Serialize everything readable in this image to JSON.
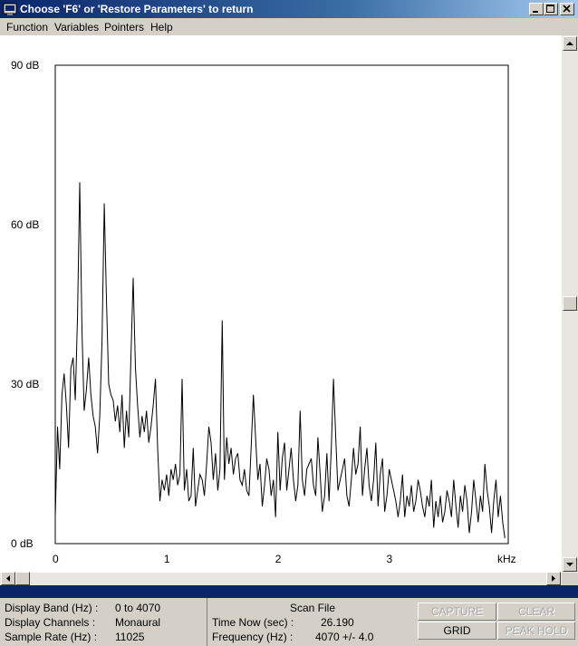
{
  "window": {
    "title": "Choose 'F6' or 'Restore Parameters' to return"
  },
  "menu": [
    "Function",
    "Variables",
    "Pointers",
    "Help"
  ],
  "chart_data": {
    "type": "line",
    "title": "",
    "xlabel": "kHz",
    "ylabel": "",
    "xlim": [
      0,
      4.07
    ],
    "ylim": [
      0,
      90
    ],
    "y_ticks": [
      "0 dB",
      "30 dB",
      "60 dB",
      "90 dB"
    ],
    "x_ticks": [
      "0",
      "1",
      "2",
      "3"
    ],
    "grid": false,
    "x": [
      0.0,
      0.02,
      0.04,
      0.06,
      0.08,
      0.1,
      0.12,
      0.14,
      0.16,
      0.18,
      0.2,
      0.22,
      0.24,
      0.26,
      0.28,
      0.3,
      0.32,
      0.34,
      0.36,
      0.38,
      0.4,
      0.42,
      0.44,
      0.46,
      0.48,
      0.5,
      0.52,
      0.54,
      0.56,
      0.58,
      0.6,
      0.62,
      0.64,
      0.66,
      0.68,
      0.7,
      0.72,
      0.74,
      0.76,
      0.78,
      0.8,
      0.82,
      0.84,
      0.86,
      0.88,
      0.9,
      0.92,
      0.94,
      0.96,
      0.98,
      1.0,
      1.02,
      1.04,
      1.06,
      1.08,
      1.1,
      1.12,
      1.14,
      1.16,
      1.18,
      1.2,
      1.22,
      1.24,
      1.26,
      1.28,
      1.3,
      1.32,
      1.34,
      1.36,
      1.38,
      1.4,
      1.42,
      1.44,
      1.46,
      1.48,
      1.5,
      1.52,
      1.54,
      1.56,
      1.58,
      1.6,
      1.62,
      1.64,
      1.66,
      1.68,
      1.7,
      1.72,
      1.74,
      1.76,
      1.78,
      1.8,
      1.82,
      1.84,
      1.86,
      1.88,
      1.9,
      1.92,
      1.94,
      1.96,
      1.98,
      2.0,
      2.02,
      2.04,
      2.06,
      2.08,
      2.1,
      2.12,
      2.14,
      2.16,
      2.18,
      2.2,
      2.22,
      2.24,
      2.26,
      2.28,
      2.3,
      2.32,
      2.34,
      2.36,
      2.38,
      2.4,
      2.42,
      2.44,
      2.46,
      2.48,
      2.5,
      2.52,
      2.54,
      2.56,
      2.58,
      2.6,
      2.62,
      2.64,
      2.66,
      2.68,
      2.7,
      2.72,
      2.74,
      2.76,
      2.78,
      2.8,
      2.82,
      2.84,
      2.86,
      2.88,
      2.9,
      2.92,
      2.94,
      2.96,
      2.98,
      3.0,
      3.02,
      3.04,
      3.06,
      3.08,
      3.1,
      3.12,
      3.14,
      3.16,
      3.18,
      3.2,
      3.22,
      3.24,
      3.26,
      3.28,
      3.3,
      3.32,
      3.34,
      3.36,
      3.38,
      3.4,
      3.42,
      3.44,
      3.46,
      3.48,
      3.5,
      3.52,
      3.54,
      3.56,
      3.58,
      3.6,
      3.62,
      3.64,
      3.66,
      3.68,
      3.7,
      3.72,
      3.74,
      3.76,
      3.78,
      3.8,
      3.82,
      3.84,
      3.86,
      3.88,
      3.9,
      3.92,
      3.94,
      3.96,
      3.98,
      4.0,
      4.02,
      4.04,
      4.06
    ],
    "series": [
      {
        "values": [
          5,
          22,
          14,
          28,
          32,
          26,
          18,
          33,
          35,
          27,
          43,
          68,
          40,
          25,
          29,
          35,
          28,
          24,
          22,
          17,
          24,
          38,
          64,
          46,
          30,
          28,
          27,
          23,
          26,
          21,
          28,
          18,
          25,
          20,
          35,
          50,
          33,
          26,
          20,
          24,
          21,
          25,
          19,
          22,
          26,
          31,
          18,
          8,
          12,
          10,
          13,
          9,
          14,
          12,
          15,
          11,
          13,
          31,
          10,
          14,
          8,
          9,
          18,
          7,
          10,
          13,
          12,
          9,
          15,
          22,
          19,
          12,
          17,
          10,
          14,
          42,
          12,
          20,
          15,
          18,
          13,
          16,
          17,
          12,
          11,
          14,
          10,
          9,
          18,
          28,
          20,
          12,
          15,
          7,
          11,
          16,
          14,
          9,
          12,
          5,
          21,
          10,
          16,
          19,
          10,
          14,
          18,
          12,
          8,
          11,
          25,
          12,
          9,
          14,
          15,
          16,
          11,
          9,
          20,
          13,
          6,
          9,
          17,
          8,
          18,
          31,
          20,
          10,
          12,
          14,
          16,
          9,
          7,
          12,
          18,
          13,
          15,
          22,
          9,
          14,
          18,
          11,
          8,
          12,
          19,
          7,
          13,
          16,
          6,
          9,
          14,
          12,
          10,
          8,
          5,
          8,
          13,
          5,
          9,
          7,
          11,
          6,
          8,
          12,
          10,
          7,
          5,
          9,
          7,
          12,
          3,
          8,
          5,
          9,
          4,
          6,
          10,
          8,
          5,
          12,
          7,
          3,
          9,
          6,
          11,
          8,
          2,
          6,
          12,
          8,
          4,
          9,
          6,
          15,
          10,
          7,
          2,
          8,
          12,
          5,
          9,
          4,
          1
        ]
      }
    ]
  },
  "status": {
    "display_band_label": "Display Band (Hz) :",
    "display_band_value": "0 to 4070",
    "display_channels_label": "Display Channels :",
    "display_channels_value": "Monaural",
    "sample_rate_label": "Sample Rate (Hz) :",
    "sample_rate_value": "11025",
    "mode": "Scan File",
    "time_now_label": "Time Now (sec) :",
    "time_now_value": "26.190",
    "frequency_label": "Frequency (Hz) :",
    "frequency_value": "4070 +/- 4.0"
  },
  "buttons": {
    "capture": "CAPTURE",
    "clear": "CLEAR",
    "grid": "GRID",
    "peak_hold": "PEAK HOLD"
  }
}
